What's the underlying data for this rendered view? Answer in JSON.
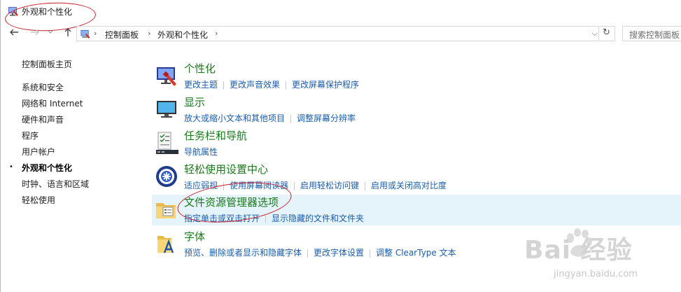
{
  "window": {
    "title": "外观和个性化"
  },
  "nav": {
    "back_icon": "arrow-left-icon",
    "forward_icon": "arrow-right-icon",
    "recent_icon": "chevron-down-icon",
    "up_icon": "arrow-up-icon",
    "crumbs": [
      "控制面板",
      "外观和个性化"
    ],
    "separator": "›",
    "dropdown": "⌵",
    "refresh": "↻",
    "search_placeholder": "搜索控制面板"
  },
  "sidebar": {
    "home": "控制面板主页",
    "items": [
      {
        "label": "系统和安全"
      },
      {
        "label": "网络和 Internet"
      },
      {
        "label": "硬件和声音"
      },
      {
        "label": "程序"
      },
      {
        "label": "用户帐户"
      },
      {
        "label": "外观和个性化",
        "active": true
      },
      {
        "label": "时钟、语言和区域"
      },
      {
        "label": "轻松使用"
      }
    ],
    "bullet": "•"
  },
  "categories": [
    {
      "title": "个性化",
      "links": [
        "更改主题",
        "更改声音效果",
        "更改屏幕保护程序"
      ]
    },
    {
      "title": "显示",
      "links": [
        "放大或缩小文本和其他项目",
        "调整屏幕分辨率"
      ]
    },
    {
      "title": "任务栏和导航",
      "links": [
        "导航属性"
      ]
    },
    {
      "title": "轻松使用设置中心",
      "links": [
        "适应弱视",
        "使用屏幕阅读器",
        "启用轻松访问键",
        "启用或关闭高对比度"
      ]
    },
    {
      "title": "文件资源管理器选项",
      "links": [
        "指定单击或双击打开",
        "显示隐藏的文件和文件夹"
      ]
    },
    {
      "title": "字体",
      "links": [
        "预览、删除或者显示和隐藏字体",
        "更改字体设置",
        "调整 ClearType 文本"
      ]
    }
  ],
  "watermark": {
    "main": "Bai  经验",
    "sub": "jingyan.baidu.com"
  },
  "colors": {
    "title_green": "#1a7a1a",
    "link_blue": "#1a5dab",
    "highlight": "#e5f3fb",
    "annotation_red": "#c81e2c"
  }
}
